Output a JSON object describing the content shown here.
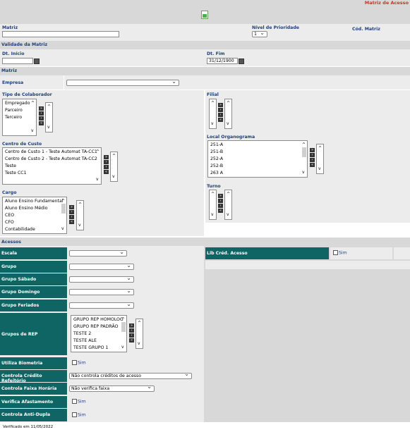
{
  "header": {
    "title": "Matriz de Acesso"
  },
  "top": {
    "matriz_label": "Matriz",
    "matriz_value": "",
    "prioridade_label": "Nível de Prioridade",
    "prioridade_value": "1",
    "cod_label": "Cód. Matriz"
  },
  "validade": {
    "section": "Validade da Matriz",
    "inicio_label": "Dt. Início",
    "inicio_value": "",
    "fim_label": "Dt. Fim",
    "fim_value": "31/12/1900"
  },
  "matriz_section": "Matriz",
  "empresa_label": "Empresa",
  "tipo_colab": {
    "label": "Tipo de Colaborador",
    "items": [
      "Empregado",
      "Parceiro",
      "Terceiro"
    ]
  },
  "filial": {
    "label": "Filial"
  },
  "centro_custo": {
    "label": "Centro de Custo",
    "items": [
      "Centro de Custo 1 - Teste Automat TA-CC1",
      "Centro de Custo 2 - Teste Automat TA-CC2",
      "Teste",
      "Teste CC1"
    ]
  },
  "local_org": {
    "label": "Local Organograma",
    "items": [
      "251-A",
      "251-B",
      "252-A",
      "252-B",
      "263 A"
    ]
  },
  "cargo": {
    "label": "Cargo",
    "items": [
      "Aluno Ensino Fundamental",
      "Aluno Ensino Médio",
      "CEO",
      "CFO",
      "Contabilidade"
    ]
  },
  "turno": {
    "label": "Turno"
  },
  "acessos": {
    "section": "Acessos",
    "escala": "Escala",
    "lib_cred": "Lib Créd. Acesso",
    "sim": "Sim",
    "grupo": "Grupo",
    "grupo_sabado": "Grupo Sábado",
    "grupo_domingo": "Grupo Domingo",
    "grupo_feriados": "Grupo Feriados",
    "grupos_rep": "Grupos de REP",
    "rep_items": [
      "GRUPO REP HOMOLOG",
      "GRUPO REP PADRÃO",
      "TESTE 2",
      "TESTE ALE",
      "TESTE GRUPO 1"
    ],
    "biometria": "Utiliza Biometria",
    "credito": "Controla Crédito Refeitório",
    "credito_value": "Não controla créditos de acesso",
    "faixa": "Controla Faixa Horária",
    "faixa_value": "Não verifica faixa",
    "afastamento": "Verifica Afastamento",
    "anti_dupla": "Controla Anti-Dupla"
  },
  "footer": {
    "text": "Verificado em 11/05/2022"
  }
}
